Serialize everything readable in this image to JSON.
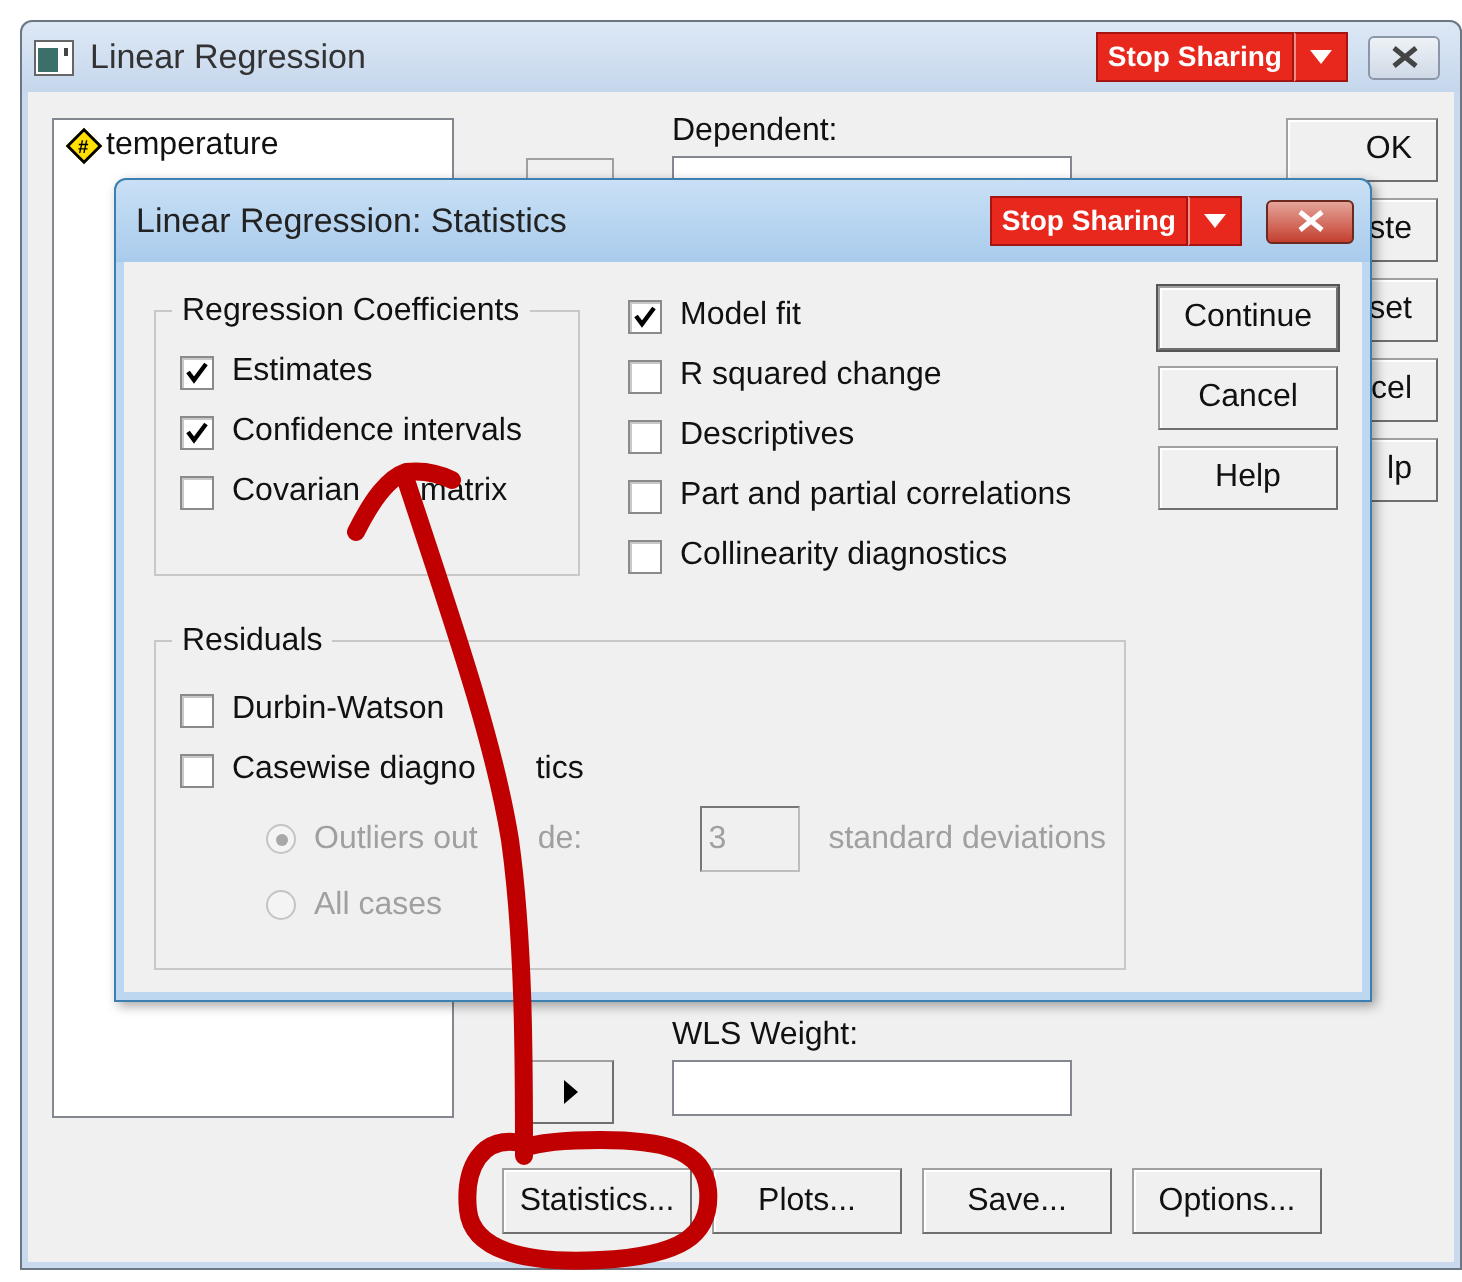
{
  "window": {
    "title": "Linear Regression",
    "share_button": "Stop Sharing"
  },
  "variables": [
    {
      "glyph": "#",
      "name": "temperature"
    }
  ],
  "dependent": {
    "label": "Dependent:"
  },
  "side_buttons": [
    "OK",
    "ste",
    "set",
    "cel",
    "lp"
  ],
  "wls": {
    "label": "WLS Weight:"
  },
  "bottom_buttons": [
    "Statistics...",
    "Plots...",
    "Save...",
    "Options..."
  ],
  "dialog": {
    "title": "Linear Regression: Statistics",
    "share_button": "Stop Sharing",
    "coefficients": {
      "title": "Regression Coefficients",
      "items": [
        {
          "label": [
            "Estimates"
          ],
          "checked": true
        },
        {
          "label": [
            "Confidence intervals"
          ],
          "checked": true
        },
        {
          "label": [
            "Covarian",
            "matrix"
          ],
          "checked": false
        }
      ]
    },
    "options": [
      {
        "label": [
          "Model fit"
        ],
        "checked": true
      },
      {
        "label": [
          "R squared change"
        ],
        "checked": false
      },
      {
        "label": [
          "Descriptives"
        ],
        "checked": false
      },
      {
        "label": [
          "Part and partial correlations"
        ],
        "checked": false
      },
      {
        "label": [
          "Collinearity diagnostics"
        ],
        "checked": false
      }
    ],
    "residuals": {
      "title": "Residuals",
      "items": [
        {
          "label": [
            "Durbin-Watson"
          ],
          "checked": false
        },
        {
          "label": [
            "Casewise diagno",
            "tics"
          ],
          "checked": false
        }
      ],
      "radios": [
        {
          "label": [
            "Outliers out",
            "de:"
          ],
          "selected": true,
          "disabled": true
        },
        {
          "label": [
            "All cases"
          ],
          "selected": false,
          "disabled": true
        }
      ],
      "outlier_value": "3",
      "outlier_units": "standard deviations"
    },
    "buttons": [
      "Continue",
      "Cancel",
      "Help"
    ]
  }
}
